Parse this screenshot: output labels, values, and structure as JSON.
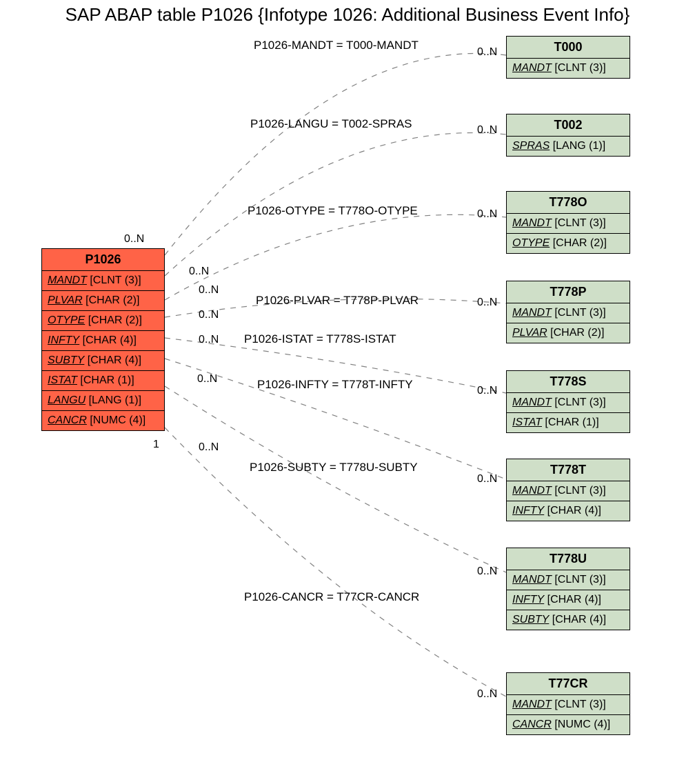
{
  "title": "SAP ABAP table P1026 {Infotype 1026: Additional Business Event Info}",
  "main_entity": {
    "name": "P1026",
    "fields": [
      {
        "name": "MANDT",
        "type": "[CLNT (3)]"
      },
      {
        "name": "PLVAR",
        "type": "[CHAR (2)]"
      },
      {
        "name": "OTYPE",
        "type": "[CHAR (2)]"
      },
      {
        "name": "INFTY",
        "type": "[CHAR (4)]"
      },
      {
        "name": "SUBTY",
        "type": "[CHAR (4)]"
      },
      {
        "name": "ISTAT",
        "type": "[CHAR (1)]"
      },
      {
        "name": "LANGU",
        "type": "[LANG (1)]"
      },
      {
        "name": "CANCR",
        "type": "[NUMC (4)]"
      }
    ]
  },
  "targets": [
    {
      "name": "T000",
      "fields": [
        {
          "name": "MANDT",
          "type": "[CLNT (3)]"
        }
      ]
    },
    {
      "name": "T002",
      "fields": [
        {
          "name": "SPRAS",
          "type": "[LANG (1)]"
        }
      ]
    },
    {
      "name": "T778O",
      "fields": [
        {
          "name": "MANDT",
          "type": "[CLNT (3)]"
        },
        {
          "name": "OTYPE",
          "type": "[CHAR (2)]"
        }
      ]
    },
    {
      "name": "T778P",
      "fields": [
        {
          "name": "MANDT",
          "type": "[CLNT (3)]"
        },
        {
          "name": "PLVAR",
          "type": "[CHAR (2)]"
        }
      ]
    },
    {
      "name": "T778S",
      "fields": [
        {
          "name": "MANDT",
          "type": "[CLNT (3)]"
        },
        {
          "name": "ISTAT",
          "type": "[CHAR (1)]"
        }
      ]
    },
    {
      "name": "T778T",
      "fields": [
        {
          "name": "MANDT",
          "type": "[CLNT (3)]"
        },
        {
          "name": "INFTY",
          "type": "[CHAR (4)]"
        }
      ]
    },
    {
      "name": "T778U",
      "fields": [
        {
          "name": "MANDT",
          "type": "[CLNT (3)]"
        },
        {
          "name": "INFTY",
          "type": "[CHAR (4)]"
        },
        {
          "name": "SUBTY",
          "type": "[CHAR (4)]"
        }
      ]
    },
    {
      "name": "T77CR",
      "fields": [
        {
          "name": "MANDT",
          "type": "[CLNT (3)]"
        },
        {
          "name": "CANCR",
          "type": "[NUMC (4)]"
        }
      ]
    }
  ],
  "edges": [
    {
      "label": "P1026-MANDT = T000-MANDT",
      "lcard": "0..N",
      "rcard": "0..N"
    },
    {
      "label": "P1026-LANGU = T002-SPRAS",
      "lcard": "0..N",
      "rcard": "0..N"
    },
    {
      "label": "P1026-OTYPE = T778O-OTYPE",
      "lcard": "0..N",
      "rcard": "0..N"
    },
    {
      "label": "P1026-PLVAR = T778P-PLVAR",
      "lcard": "0..N",
      "rcard": "0..N"
    },
    {
      "label": "P1026-ISTAT = T778S-ISTAT",
      "lcard": "0..N",
      "rcard": "0..N"
    },
    {
      "label": "P1026-INFTY = T778T-INFTY",
      "lcard": "0..N",
      "rcard": "0..N"
    },
    {
      "label": "P1026-SUBTY = T778U-SUBTY",
      "lcard": "0..N",
      "rcard": "0..N"
    },
    {
      "label": "P1026-CANCR = T77CR-CANCR",
      "lcard": "1",
      "rcard": "0..N"
    }
  ]
}
